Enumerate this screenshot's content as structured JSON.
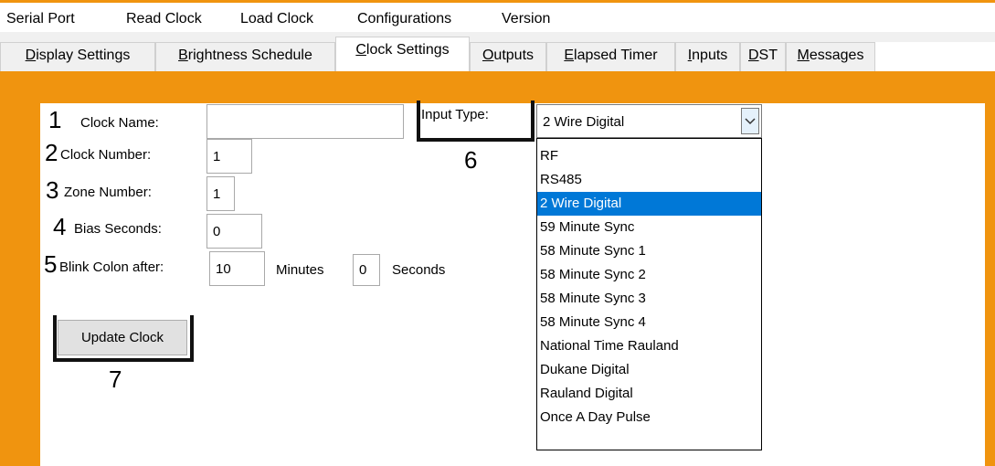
{
  "menu": [
    "Serial Port",
    "Read Clock",
    "Load Clock",
    "Configurations",
    "Version"
  ],
  "tabs": [
    {
      "accel": "D",
      "rest": "isplay Settings"
    },
    {
      "accel": "B",
      "rest": "rightness Schedule"
    },
    {
      "accel": "C",
      "rest": "lock Settings"
    },
    {
      "accel": "O",
      "rest": "utputs"
    },
    {
      "accel": "E",
      "rest": "lapsed Timer"
    },
    {
      "accel": "I",
      "rest": "nputs"
    },
    {
      "accel": "D",
      "rest": "ST"
    },
    {
      "accel": "M",
      "rest": "essages"
    }
  ],
  "active_tab": "Clock Settings",
  "form": {
    "clock_name": {
      "number": "1",
      "label": "Clock Name:",
      "value": ""
    },
    "clock_number": {
      "number": "2",
      "label": "Clock Number:",
      "value": "1"
    },
    "zone_number": {
      "number": "3",
      "label": "Zone Number:",
      "value": "1"
    },
    "bias_seconds": {
      "number": "4",
      "label": "Bias Seconds:",
      "value": "0"
    },
    "blink_colon": {
      "number": "5",
      "label": "Blink Colon after:",
      "minutes_value": "10",
      "minutes_label": "Minutes",
      "seconds_value": "0",
      "seconds_label": "Seconds"
    }
  },
  "input_type": {
    "number": "6",
    "label": "Input Type:",
    "selected": "2 Wire Digital",
    "options": [
      "RF",
      "RS485",
      "2 Wire Digital",
      "59 Minute Sync",
      "58 Minute Sync 1",
      "58 Minute Sync 2",
      "58 Minute Sync 3",
      "58 Minute Sync 4",
      "National Time Rauland",
      "Dukane Digital",
      "Rauland Digital",
      "Once A Day Pulse"
    ]
  },
  "update_button": {
    "number": "7",
    "label": "Update Clock"
  },
  "colors": {
    "background": "#f0940f",
    "selection": "#0078d7",
    "callout": "#111111"
  }
}
